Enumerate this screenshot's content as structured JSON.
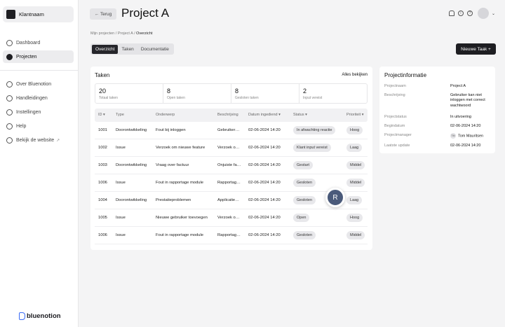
{
  "sidebar": {
    "brand": "Klantnaam",
    "main_items": [
      {
        "label": "Dashboard",
        "active": false
      },
      {
        "label": "Projecten",
        "active": true
      }
    ],
    "secondary_items": [
      {
        "label": "Over Bluenotion"
      },
      {
        "label": "Handleidingen"
      },
      {
        "label": "Instellingen"
      },
      {
        "label": "Help"
      },
      {
        "label": "Bekijk de website",
        "external_icon": "external-link-icon"
      }
    ],
    "footer_logo": "bluenotion"
  },
  "header": {
    "back_label": "← Terug",
    "title": "Project A",
    "icons": [
      "bell-icon",
      "info-icon",
      "help-icon"
    ],
    "chevron": "⌄"
  },
  "breadcrumb": {
    "part1": "Mijn projecten / ",
    "part2": "Project A / ",
    "current": "Overzicht"
  },
  "tabs": [
    {
      "label": "Overzicht",
      "active": true
    },
    {
      "label": "Taken",
      "active": false
    },
    {
      "label": "Documentatie",
      "active": false
    }
  ],
  "new_task_button": "Nieuwe Taak +",
  "tasks": {
    "title": "Taken",
    "see_all": "Alles bekijken",
    "stats": [
      {
        "value": "20",
        "label": "Totaal taken"
      },
      {
        "value": "8",
        "label": "Open taken"
      },
      {
        "value": "8",
        "label": "Gesloten taken"
      },
      {
        "value": "2",
        "label": "Input vereist"
      }
    ],
    "columns": {
      "id": "ID ▾",
      "type": "Type",
      "subject": "Onderwerp",
      "description": "Beschrijving",
      "date": "Datum ingediend ▾",
      "status": "Status ▾",
      "priority": "Prioriteit ▾"
    },
    "rows": [
      {
        "id": "1001",
        "type": "Doorontwikkeling",
        "subject": "Fout bij inloggen",
        "description": "Gebruiker…",
        "date": "02-06-2024 14:20",
        "status": "In afwachting reactie",
        "priority": "Hoog"
      },
      {
        "id": "1002",
        "type": "Issue",
        "subject": "Verzoek om nieuwe feature",
        "description": "Verzoek o…",
        "date": "02-06-2024 14:20",
        "status": "Klant input vereist",
        "priority": "Laag"
      },
      {
        "id": "1003",
        "type": "Doorontwikkeling",
        "subject": "Vraag over factuur",
        "description": "Onjuiste fa…",
        "date": "02-06-2024 14:20",
        "status": "Gestart",
        "priority": "Middel"
      },
      {
        "id": "1006",
        "type": "Issue",
        "subject": "Fout in rapportage module",
        "description": "Rapportag…",
        "date": "02-06-2024 14:20",
        "status": "Gesloten",
        "priority": "Middel"
      },
      {
        "id": "1004",
        "type": "Doorontwikkeling",
        "subject": "Prestatieproblemen",
        "description": "Applicatie…",
        "date": "02-06-2024 14:20",
        "status": "Gesloten",
        "priority": "Laag"
      },
      {
        "id": "1005",
        "type": "Issue",
        "subject": "Nieuwe gebruiker toevoegen",
        "description": "Verzoek o…",
        "date": "02-06-2024 14:20",
        "status": "Open",
        "priority": "Hoog"
      },
      {
        "id": "1006",
        "type": "Issue",
        "subject": "Fout in rapportage module",
        "description": "Rapportag…",
        "date": "02-06-2024 14:20",
        "status": "Gesloten",
        "priority": "Middel"
      }
    ]
  },
  "fab": {
    "letter": "R"
  },
  "project_info": {
    "title": "Projectinformatie",
    "fields": [
      {
        "key": "Projectnaam",
        "value": "Project A"
      },
      {
        "key": "Beschrijving",
        "value": "Gebruiker kan niet inloggen met correct wachtwoord"
      },
      {
        "key": "Projectstatus",
        "value": "In uitvoering"
      },
      {
        "key": "Begindatum",
        "value": "02-06-2024 14:20"
      },
      {
        "key": "Projectmanager",
        "value": "Tom Mauritsen",
        "initials": "TM"
      },
      {
        "key": "Laatste update",
        "value": "02-06-2024 14:20"
      }
    ]
  }
}
